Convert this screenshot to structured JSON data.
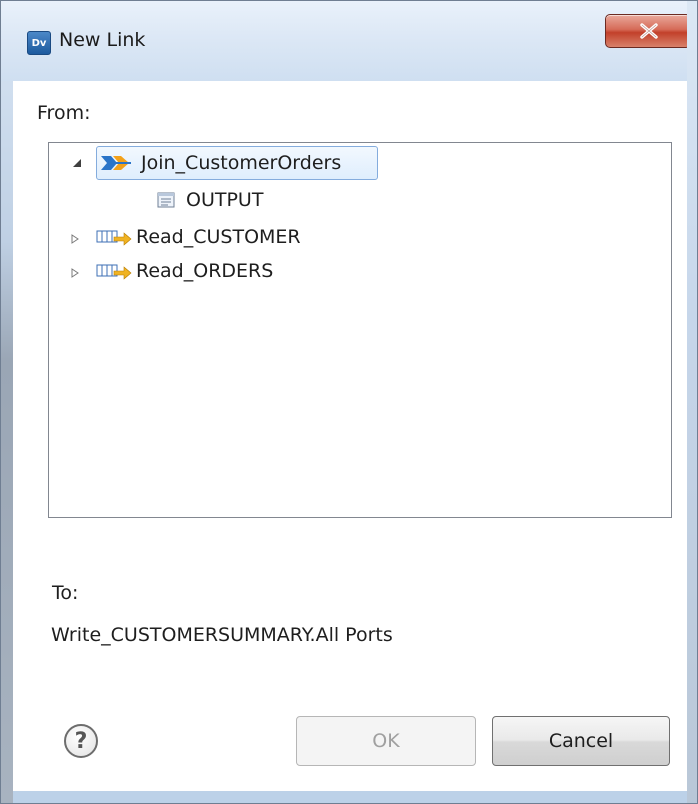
{
  "window": {
    "title": "New Link",
    "app_icon_text": "Dv"
  },
  "dialog": {
    "from_label": "From:",
    "tree": [
      {
        "label": "Join_CustomerOrders",
        "icon": "joiner-transform-icon",
        "expanded": true,
        "selected": true
      },
      {
        "label": "OUTPUT",
        "icon": "output-group-icon"
      },
      {
        "label": "Read_CUSTOMER",
        "icon": "read-source-icon",
        "expanded": false
      },
      {
        "label": "Read_ORDERS",
        "icon": "read-source-icon",
        "expanded": false
      }
    ],
    "to_label": "To:",
    "to_value": "Write_CUSTOMERSUMMARY.All Ports"
  },
  "buttons": {
    "help_symbol": "?",
    "ok_label": "OK",
    "ok_enabled": false,
    "cancel_label": "Cancel"
  },
  "colors": {
    "selection_border": "#84acdd",
    "close_button": "#c2402a"
  }
}
